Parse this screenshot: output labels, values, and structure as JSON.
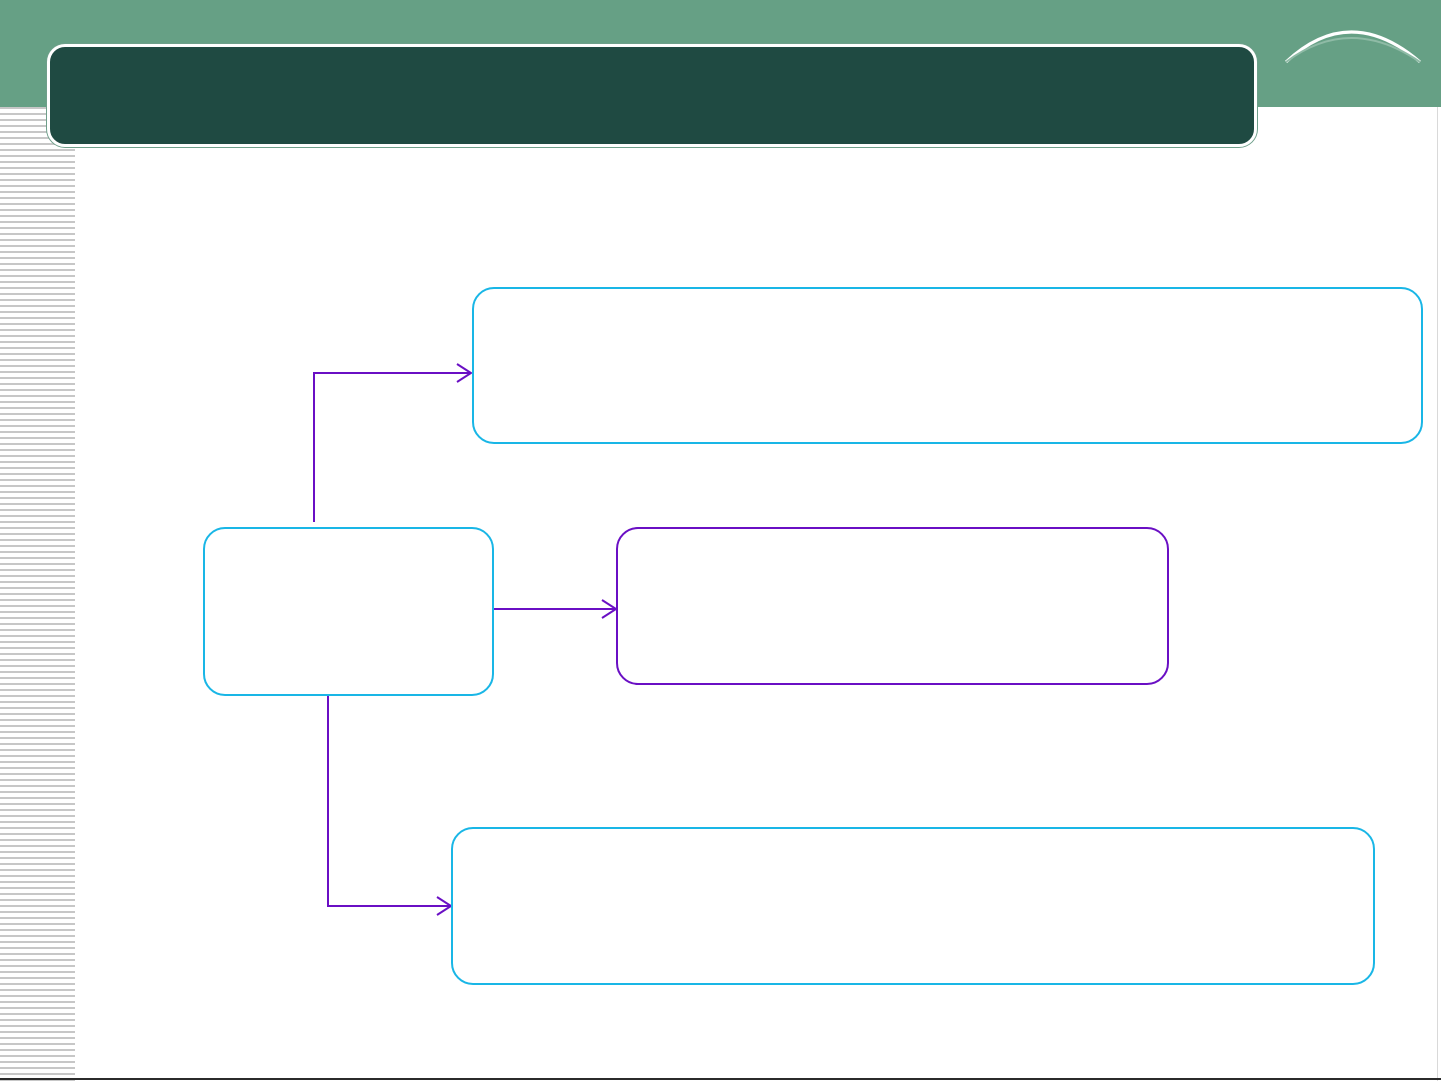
{
  "slide": {
    "title": "",
    "colors": {
      "band": "#66a085",
      "title_bar": "#1f4a42",
      "cyan_border": "#19b6e6",
      "purple_border": "#6a0fc4",
      "connector": "#6a0fc4"
    }
  },
  "diagram": {
    "source_box": {
      "text": ""
    },
    "targets": [
      {
        "text": ""
      },
      {
        "text": ""
      },
      {
        "text": ""
      }
    ]
  }
}
